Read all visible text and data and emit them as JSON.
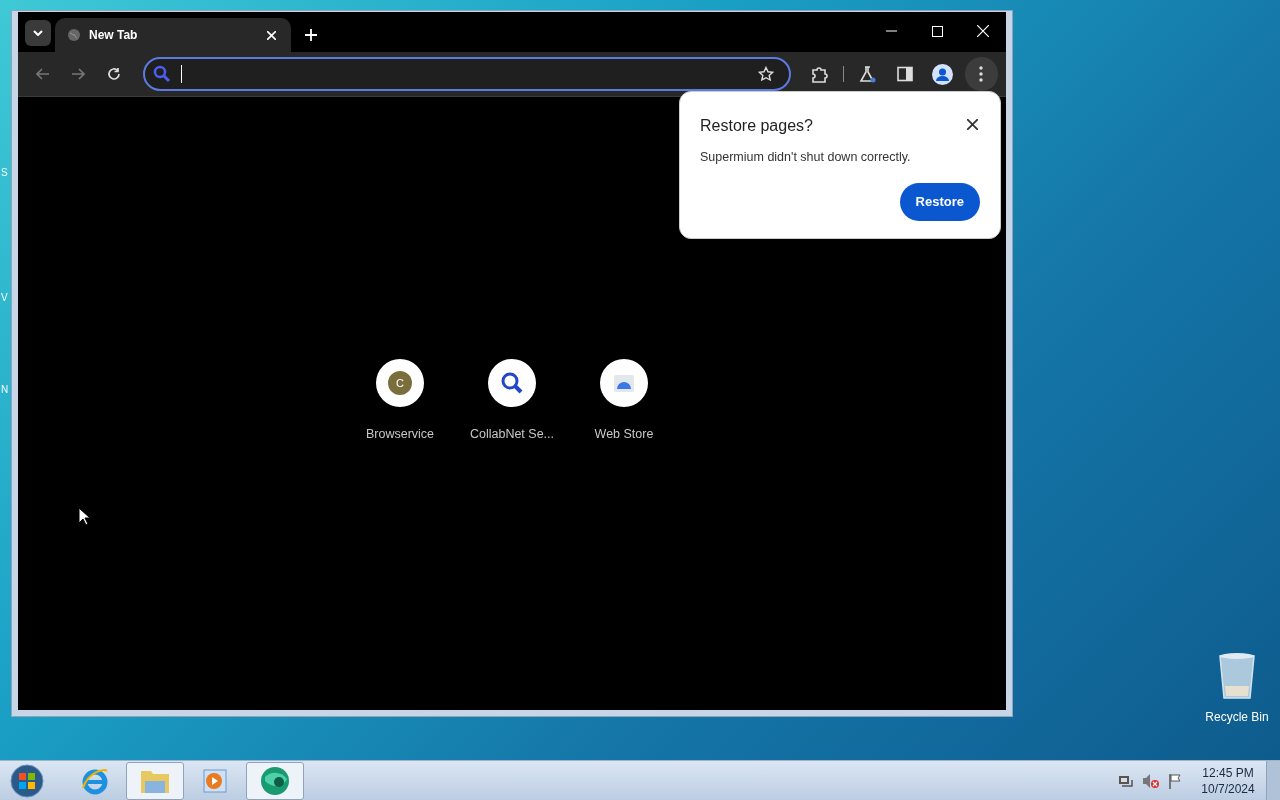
{
  "desktop": {
    "edge_letters": [
      "S",
      "V",
      "N"
    ],
    "icons": [
      {
        "label": "Recycle Bin",
        "kind": "recycle"
      }
    ]
  },
  "browser": {
    "tabs": [
      {
        "title": "New Tab",
        "selected": true
      }
    ],
    "omnibox": {
      "focused": true
    },
    "dialog": {
      "title": "Restore pages?",
      "message": "Supermium didn't shut down correctly.",
      "button": "Restore"
    },
    "shortcuts": [
      {
        "label": "Browservice",
        "kind": "letter",
        "letter": "C"
      },
      {
        "label": "CollabNet Se...",
        "kind": "search"
      },
      {
        "label": "Web Store",
        "kind": "store"
      }
    ]
  },
  "taskbar": {
    "apps": [
      {
        "kind": "ie",
        "active": false
      },
      {
        "kind": "explorer",
        "active": true
      },
      {
        "kind": "media",
        "active": false
      },
      {
        "kind": "browser",
        "active": true
      }
    ],
    "clock": {
      "time": "12:45 PM",
      "date": "10/7/2024"
    }
  }
}
